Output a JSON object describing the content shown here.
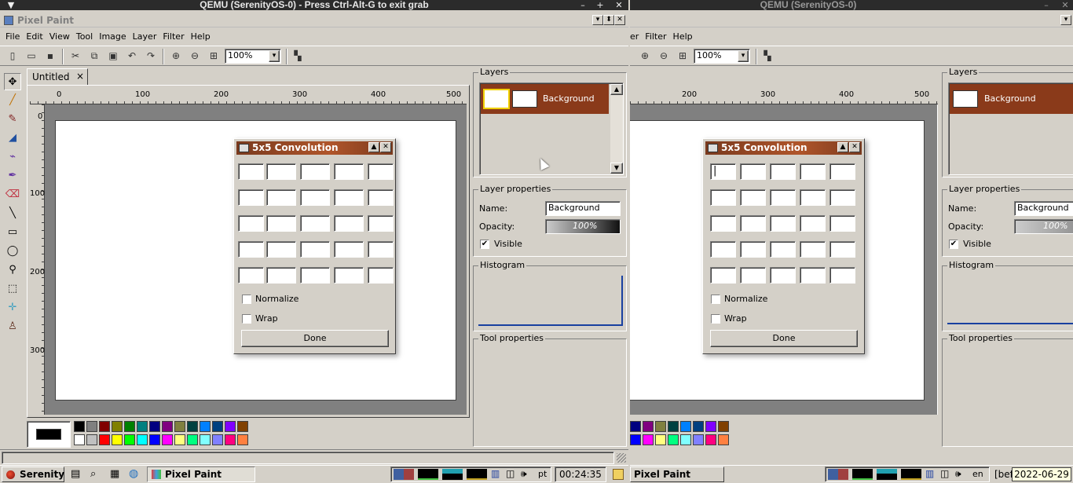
{
  "qemu_left": {
    "title": "QEMU (SerenityOS-0) - Press Ctrl-Alt-G to exit grab",
    "menu_glyph": "▼",
    "min": "–",
    "max": "+",
    "close": "✕"
  },
  "qemu_right": {
    "title": "QEMU (SerenityOS-0)",
    "min": "–",
    "close": "✕"
  },
  "app": {
    "title": "Pixel Paint",
    "title_buttons": {
      "min": "▾",
      "max": "⬍",
      "close": "✕"
    },
    "right_dropdown": "▾"
  },
  "menu": {
    "file": "File",
    "edit": "Edit",
    "view": "View",
    "tool": "Tool",
    "image": "Image",
    "layer": "Layer",
    "filter": "Filter",
    "help": "Help",
    "right_partial_layer": "er",
    "right_filter": "Filter",
    "right_help": "Help"
  },
  "toolbar": {
    "zoom_value": "100%",
    "zoom_value_right": "100%",
    "dropdown_glyph": "▾",
    "icons": {
      "new": "▯",
      "open": "▭",
      "save": "▪",
      "cut": "✂",
      "copy": "⧉",
      "paste": "▣",
      "undo": "↶",
      "redo": "↷",
      "zoom_in": "⊕",
      "zoom_out": "⊖",
      "actual_size": "⊞",
      "levels": "▚"
    }
  },
  "tools": [
    "✥",
    "╱",
    "✎",
    "◢",
    "⌁",
    "✒",
    "⌫",
    "╲",
    "▭",
    "◯",
    "⚲",
    "⬚",
    "✛",
    "♙"
  ],
  "tab": {
    "label": "Untitled",
    "close": "×"
  },
  "ruler": {
    "top": [
      "0",
      "100",
      "200",
      "300",
      "400",
      "500"
    ],
    "top_right": [
      "200",
      "300",
      "400",
      "500"
    ],
    "left": [
      "0",
      "100",
      "200",
      "300"
    ]
  },
  "dialog": {
    "title": "5x5 Convolution",
    "normalize": "Normalize",
    "wrap": "Wrap",
    "done": "Done",
    "minimize": "▲",
    "close": "✕",
    "cursor": "|"
  },
  "layers": {
    "label": "Layers",
    "item": "Background"
  },
  "layer_props": {
    "label": "Layer properties",
    "name_label": "Name:",
    "name_value": "Background",
    "opacity_label": "Opacity:",
    "opacity_value": "100%",
    "visible_label": "Visible",
    "visible_mark": "✔"
  },
  "histogram": {
    "label": "Histogram"
  },
  "tool_props": {
    "label": "Tool properties"
  },
  "palette": {
    "row1": [
      "#000000",
      "#808080",
      "#800000",
      "#808000",
      "#008000",
      "#008080",
      "#000080",
      "#800080",
      "#808040",
      "#004040",
      "#0080ff",
      "#004080",
      "#8000ff",
      "#804000"
    ],
    "row2": [
      "#ffffff",
      "#c0c0c0",
      "#ff0000",
      "#ffff00",
      "#00ff00",
      "#00ffff",
      "#0000ff",
      "#ff00ff",
      "#ffff80",
      "#00ff80",
      "#80ffff",
      "#8080ff",
      "#ff0080",
      "#ff8040"
    ],
    "right_row1": [
      "#000080",
      "#800080",
      "#808040",
      "#004040",
      "#0080ff",
      "#004080",
      "#8000ff",
      "#804000"
    ],
    "right_row2": [
      "#0000ff",
      "#ff00ff",
      "#ffff80",
      "#00ff80",
      "#80ffff",
      "#8080ff",
      "#ff0080",
      "#ff8040"
    ],
    "primary": "#000000"
  },
  "taskbar": {
    "start": "Serenity",
    "task": "Pixel Paint",
    "task_right": "Pixel Paint",
    "lang_left": "pt",
    "lang_right": "en",
    "clock": "00:24:35",
    "date": "2022-06-29",
    "partial": "[bef",
    "quick_icons": [
      "▤",
      "⌕",
      "▦",
      "◍"
    ],
    "tray_icons": [
      "▥",
      "◫",
      "🕪"
    ]
  }
}
